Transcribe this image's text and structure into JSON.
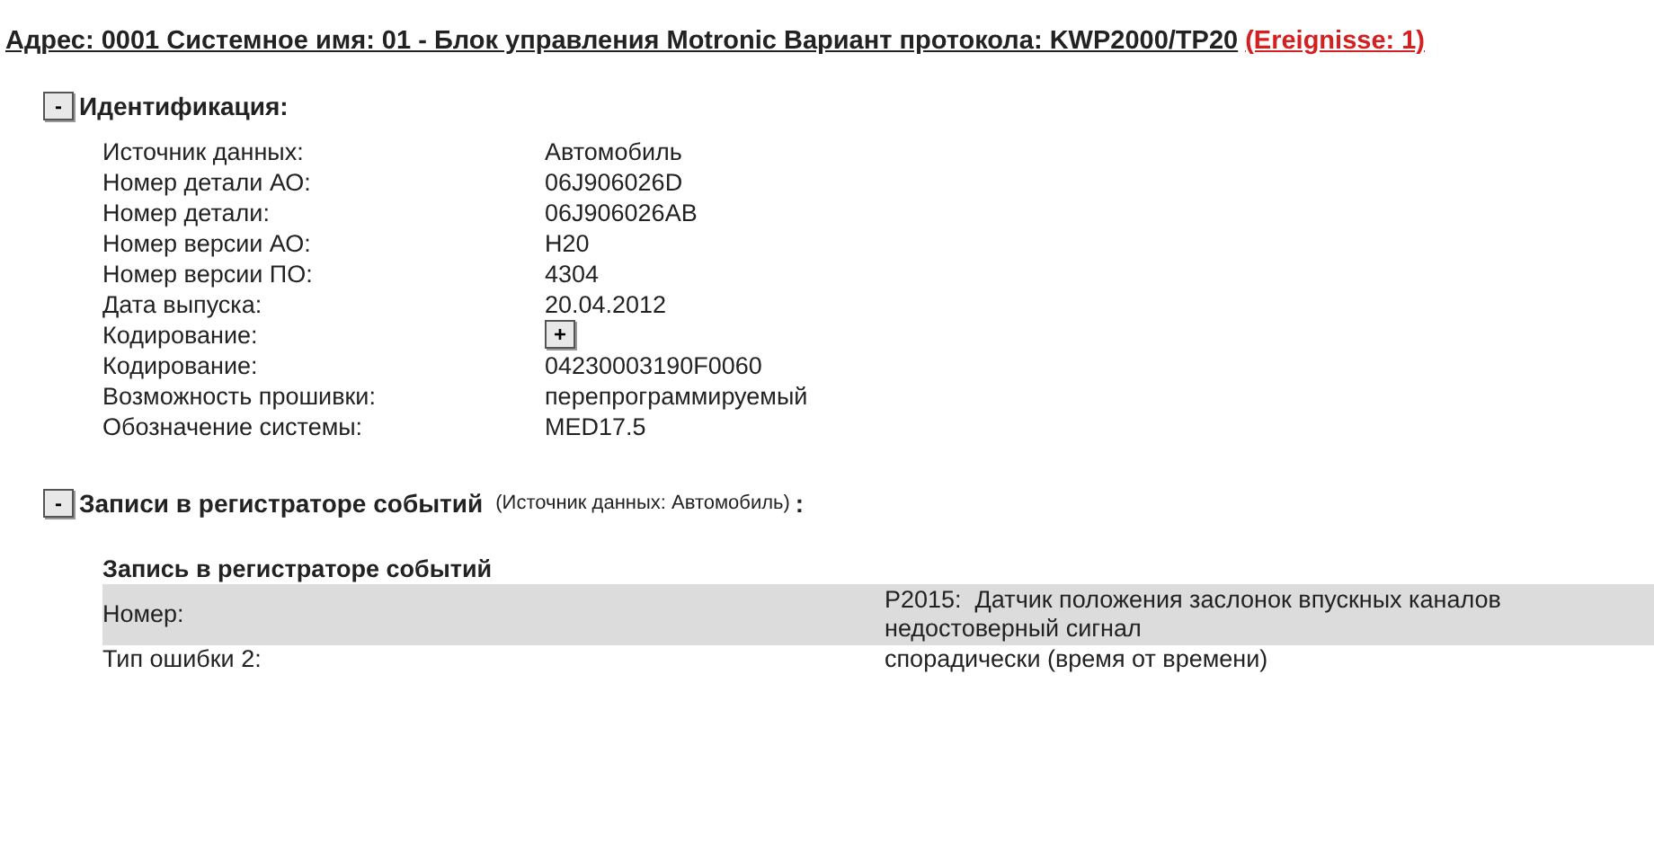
{
  "header": {
    "text": "Адрес: 0001 Системное имя: 01 - Блок управления Motronic Вариант протокола: KWP2000/TP20",
    "link": "(Ereignisse: 1)"
  },
  "sections": [
    {
      "toggle": "-",
      "title": "Идентификация:",
      "rows": [
        {
          "kind": "text",
          "label": "Источник данных:",
          "value": "Автомобиль"
        },
        {
          "kind": "text",
          "label": "Номер детали АО:",
          "value": "06J906026D"
        },
        {
          "kind": "text",
          "label": "Номер детали:",
          "value": "06J906026AB"
        },
        {
          "kind": "text",
          "label": "Номер версии АО:",
          "value": "H20"
        },
        {
          "kind": "text",
          "label": "Номер версии ПО:",
          "value": "4304"
        },
        {
          "kind": "text",
          "label": "Дата выпуска:",
          "value": "20.04.2012"
        },
        {
          "kind": "button",
          "label": "Кодирование:",
          "value": "+"
        },
        {
          "kind": "text",
          "label": "Кодирование:",
          "value": "04230003190F0060"
        },
        {
          "kind": "text",
          "label": "Возможность прошивки:",
          "value": "перепрограммируемый"
        },
        {
          "kind": "text",
          "label": "Обозначение системы:",
          "value": "MED17.5"
        }
      ]
    },
    {
      "toggle": "-",
      "title": "Записи в регистраторе событий",
      "note": "(Источник данных: Автомобиль)",
      "suffix": ":",
      "table": {
        "title": "Запись в регистраторе событий",
        "rows": [
          {
            "label": "Номер:",
            "value": "P2015:  Датчик положения заслонок впускных каналов недостоверный сигнал",
            "shaded": true
          },
          {
            "label": "Тип ошибки 2:",
            "value": "спорадически (время от времени)",
            "shaded": false
          }
        ]
      }
    }
  ]
}
